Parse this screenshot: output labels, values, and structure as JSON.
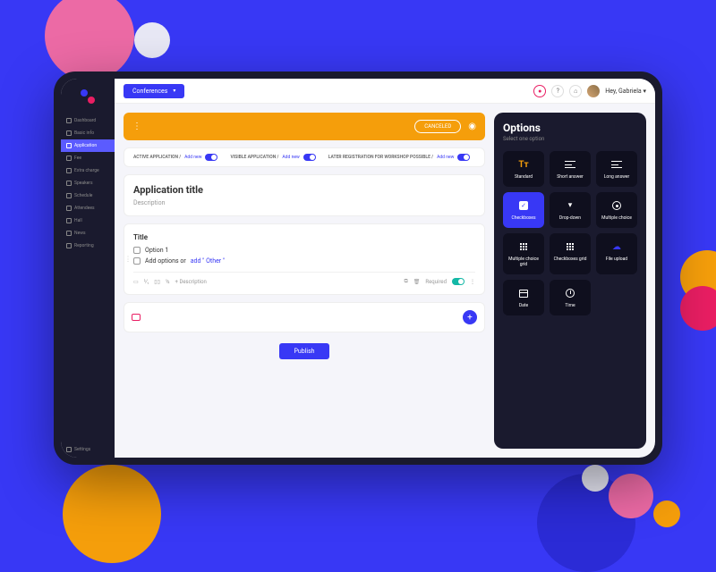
{
  "sidebar": {
    "items": [
      {
        "label": "Dashboard"
      },
      {
        "label": "Basic info"
      },
      {
        "label": "Application"
      },
      {
        "label": "Fee"
      },
      {
        "label": "Extra charge"
      },
      {
        "label": "Speakers"
      },
      {
        "label": "Schedule"
      },
      {
        "label": "Attendees"
      },
      {
        "label": "Hall"
      },
      {
        "label": "News"
      },
      {
        "label": "Reporting"
      }
    ],
    "settings": "Settings"
  },
  "topbar": {
    "conferences": "Conferences",
    "greeting": "Hey, Gabriela"
  },
  "orange": {
    "cancel": "CANCELED"
  },
  "toggles": {
    "t1": {
      "label": "ACTIVE APPLICATION /",
      "link": "Add new"
    },
    "t2": {
      "label": "VISIBLE APPLICATION /",
      "link": "Add new"
    },
    "t3": {
      "label": "LATER REGISTRATION FOR WORKSHOP POSSIBLE /",
      "link": "Add new"
    }
  },
  "titleCard": {
    "title": "Application title",
    "desc": "Description"
  },
  "question": {
    "title": "Title",
    "option1": "Option 1",
    "addOptions": "Add options or ",
    "addOther": "add \" Other \"",
    "col1": "⅟₁",
    "col2": "½",
    "addDesc": "+ Description",
    "required": "Required"
  },
  "publish": "Publish",
  "options": {
    "title": "Options",
    "subtitle": "Select one option",
    "items": [
      {
        "label": "Standard"
      },
      {
        "label": "Short answer"
      },
      {
        "label": "Long answer"
      },
      {
        "label": "Checkboxes"
      },
      {
        "label": "Drop-down"
      },
      {
        "label": "Multiple choice"
      },
      {
        "label": "Multiple choice grid"
      },
      {
        "label": "Checkboxes grid"
      },
      {
        "label": "File upload"
      },
      {
        "label": "Date"
      },
      {
        "label": "Time"
      }
    ]
  }
}
